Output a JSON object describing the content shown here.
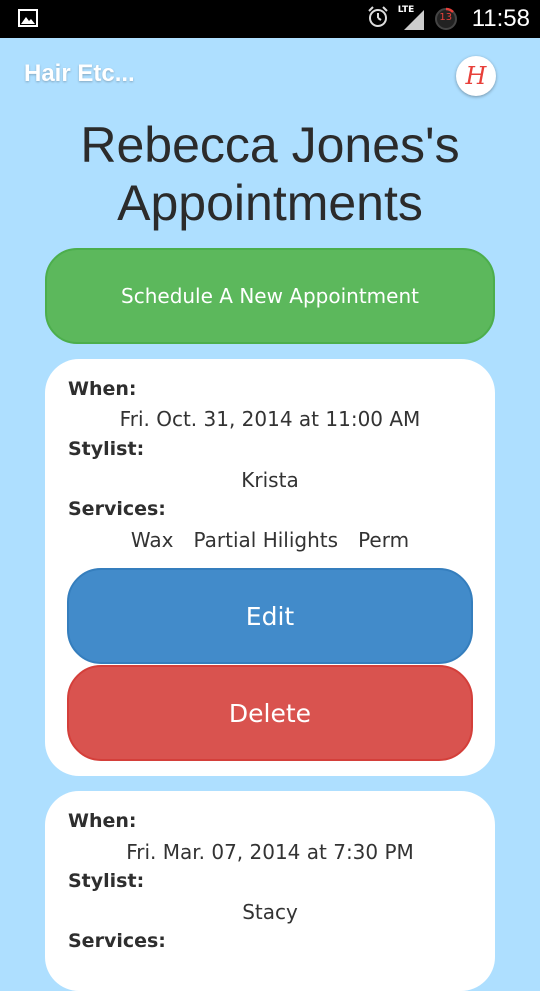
{
  "status_bar": {
    "time": "11:58",
    "battery_level": "13",
    "network": "LTE",
    "icons": [
      "image-icon",
      "alarm-icon",
      "signal-icon",
      "battery-icon"
    ]
  },
  "header": {
    "app_title": "Hair Etc...",
    "logo_letter": "H"
  },
  "page": {
    "title_line1": "Rebecca Jones's",
    "title_line2": "Appointments"
  },
  "schedule_button_label": "Schedule A New Appointment",
  "labels": {
    "when": "When:",
    "stylist": "Stylist:",
    "services": "Services:"
  },
  "appointments": [
    {
      "when": "Fri. Oct. 31, 2014 at 11:00 AM",
      "stylist": "Krista",
      "services": [
        "Wax",
        "Partial Hilights",
        "Perm"
      ],
      "edit_label": "Edit",
      "delete_label": "Delete"
    },
    {
      "when": "Fri. Mar. 07, 2014 at 7:30 PM",
      "stylist": "Stacy"
    }
  ],
  "colors": {
    "background": "#aedfff",
    "status_bar": "#000000",
    "schedule_button": "#5cb85c",
    "edit_button": "#428bca",
    "delete_button": "#d9534f",
    "logo_accent": "#e8403a"
  }
}
